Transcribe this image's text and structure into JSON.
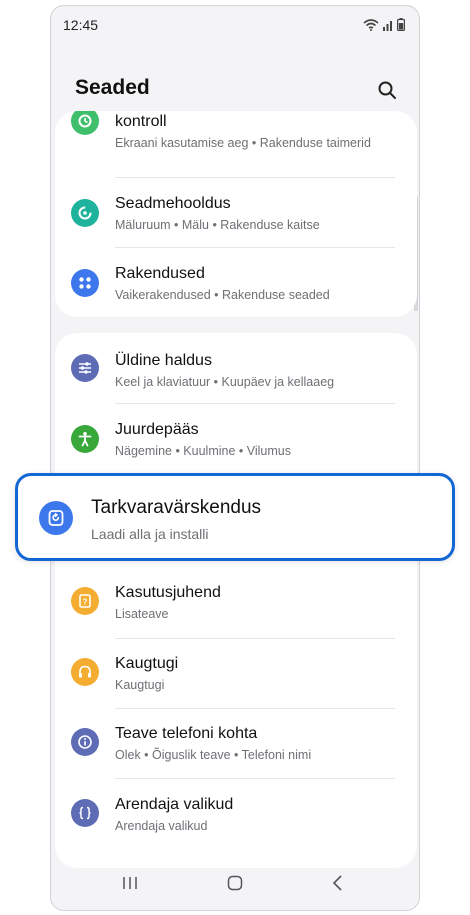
{
  "status_bar": {
    "time": "12:45",
    "icons": [
      "wifi-icon",
      "signal-icon",
      "battery-icon"
    ]
  },
  "header": {
    "title": "Seaded",
    "search_icon": "search-icon"
  },
  "groups": [
    {
      "items": [
        {
          "title": "kontroll",
          "subtitle": "Ekraani kasutamise aeg  •  Rakenduse taimerid",
          "icon": "digital-wellbeing-icon",
          "color": "#3fbf6b"
        },
        {
          "title": "Seadmehooldus",
          "subtitle": "Mäluruum  •  Mälu  •  Rakenduse kaitse",
          "icon": "device-care-icon",
          "color": "#1fb39e"
        },
        {
          "title": "Rakendused",
          "subtitle": "Vaikerakendused  •  Rakenduse seaded",
          "icon": "apps-icon",
          "color": "#3c78eb"
        }
      ]
    },
    {
      "items": [
        {
          "title": "Üldine haldus",
          "subtitle": "Keel ja klaviatuur  •  Kuupäev ja kellaaeg",
          "icon": "general-management-icon",
          "color": "#5e6bb5"
        },
        {
          "title": "Juurdepääs",
          "subtitle": "Nägemine  •  Kuulmine  •  Vilumus",
          "icon": "accessibility-icon",
          "color": "#39a83b"
        },
        {
          "title": "Kasutusjuhend",
          "subtitle": "Lisateave",
          "icon": "user-manual-icon",
          "color": "#f4ad30"
        },
        {
          "title": "Kaugtugi",
          "subtitle": "Kaugtugi",
          "icon": "remote-support-icon",
          "color": "#f4ad30"
        },
        {
          "title": "Teave telefoni kohta",
          "subtitle": "Olek  •  Õiguslik teave  •  Telefoni nimi",
          "icon": "about-phone-icon",
          "color": "#5e6bb5"
        },
        {
          "title": "Arendaja valikud",
          "subtitle": "Arendaja valikud",
          "icon": "developer-options-icon",
          "color": "#5e6bb5"
        }
      ]
    }
  ],
  "highlighted": {
    "title": "Tarkvaravärskendus",
    "subtitle": "Laadi alla ja installi",
    "icon": "software-update-icon",
    "color": "#3c78eb",
    "border_color": "#1367d4"
  },
  "nav_bar": {
    "recents_icon": "recents-icon",
    "home_icon": "home-icon",
    "back_icon": "back-icon"
  }
}
